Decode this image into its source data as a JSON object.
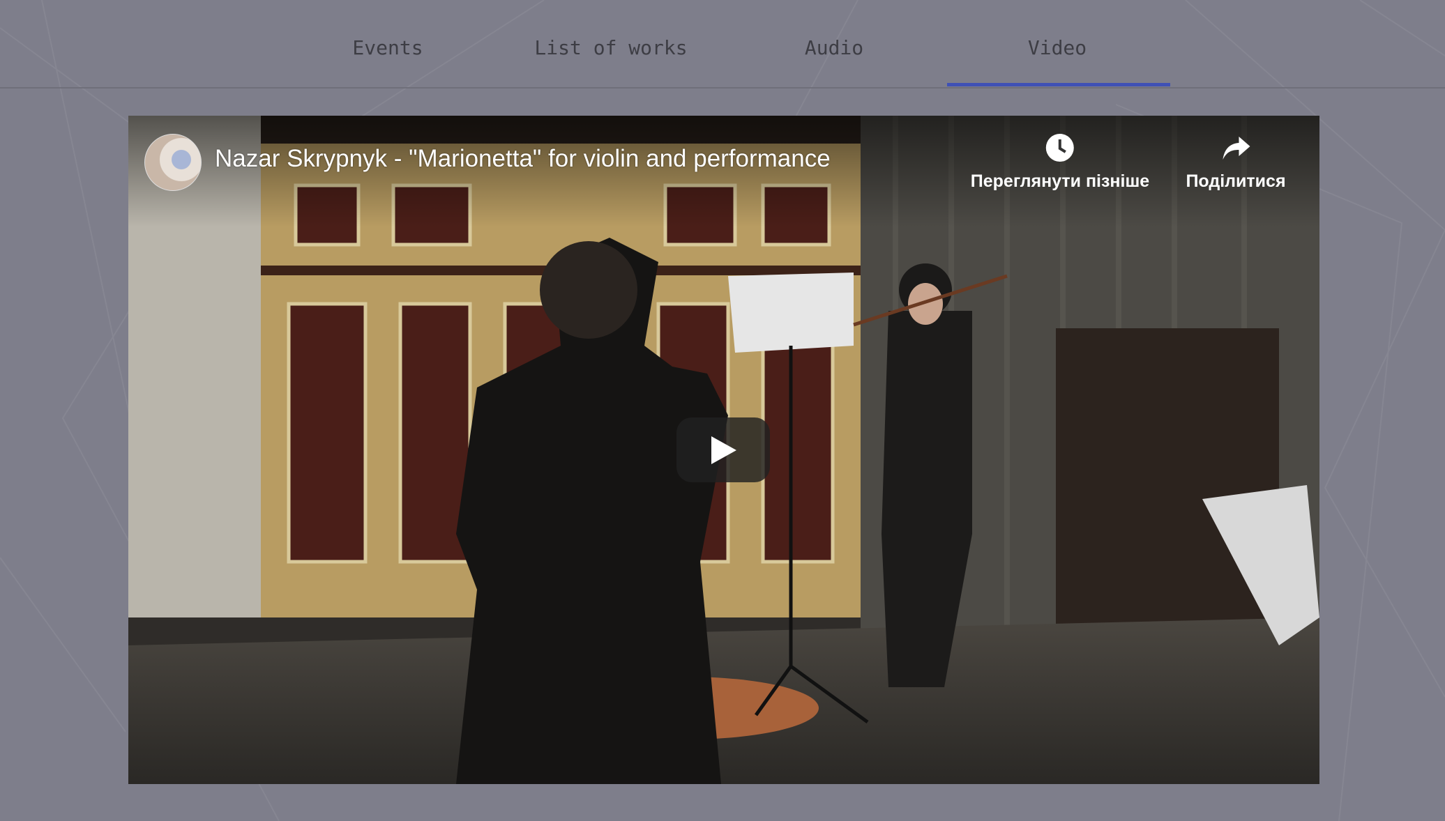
{
  "tabs": [
    {
      "label": "Events",
      "active": false
    },
    {
      "label": "List of works",
      "active": false
    },
    {
      "label": "Audio",
      "active": false
    },
    {
      "label": "Video",
      "active": true
    }
  ],
  "accent_color": "#3f51b5",
  "video": {
    "title": "Nazar Skrypnyk - \"Marionetta\" for violin and performance",
    "watch_later_label": "Переглянути пізніше",
    "share_label": "Поділитися",
    "icons": {
      "watch_later": "clock-icon",
      "share": "share-arrow-icon",
      "play": "play-icon"
    }
  }
}
